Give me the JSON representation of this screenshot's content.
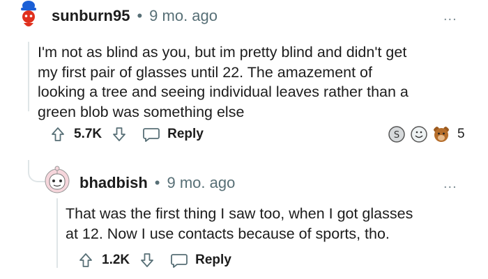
{
  "comments": [
    {
      "username": "sunburn95",
      "separator": "•",
      "time": "9 mo. ago",
      "more": "...",
      "body": [
        "I'm not as blind as you, but im pretty blind and didn't get",
        "my first pair of glasses until 22. The amazement of",
        "looking a tree and seeing individual leaves rather than a",
        "green blob was something else"
      ],
      "votes": "5.7K",
      "reply_label": "Reply",
      "awards_count": "5"
    },
    {
      "username": "bhadbish",
      "separator": "•",
      "time": "9 mo. ago",
      "more": "...",
      "body": [
        "That was the first thing I saw too, when I got glasses",
        "at 12. Now I use contacts because of sports, tho."
      ],
      "votes": "1.2K",
      "reply_label": "Reply"
    }
  ],
  "colors": {
    "meta": "#576f76",
    "thread_line": "#dfe5e7",
    "avatar1_hat": "#1a5fd6",
    "avatar1_head": "#e0301e"
  }
}
